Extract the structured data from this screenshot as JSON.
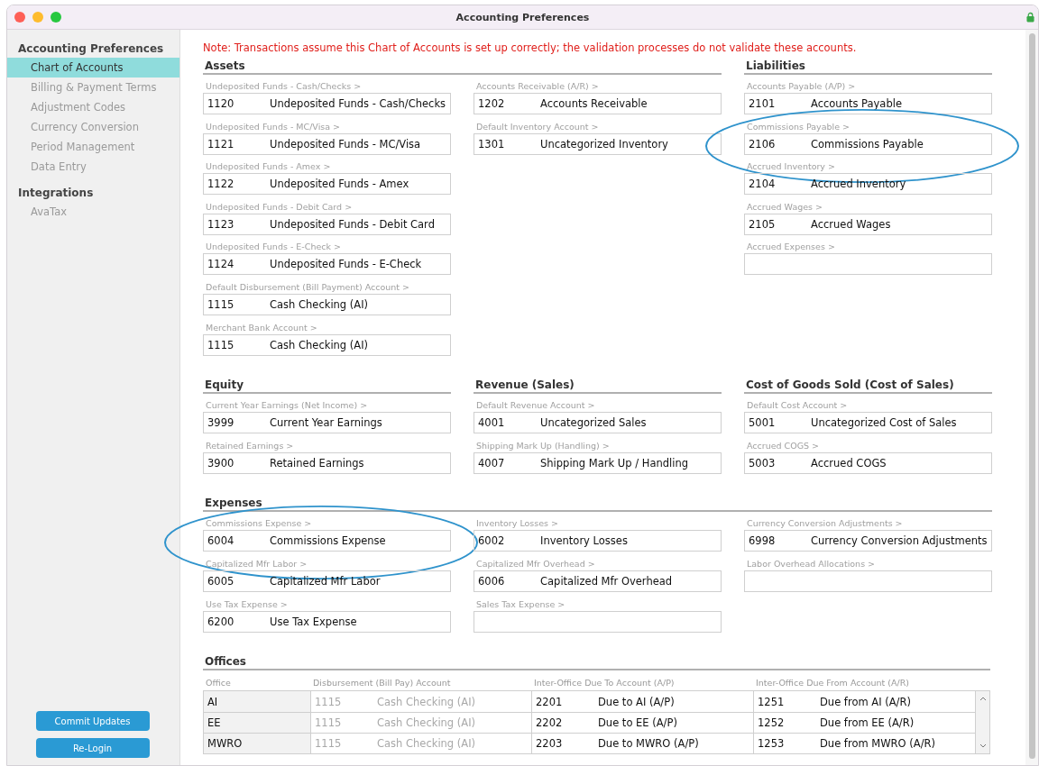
{
  "window": {
    "title": "Accounting Preferences"
  },
  "sidebar": {
    "groups": [
      {
        "title": "Accounting Preferences",
        "items": [
          {
            "label": "Chart of Accounts",
            "selected": true
          },
          {
            "label": "Billing & Payment Terms",
            "selected": false
          },
          {
            "label": "Adjustment Codes",
            "selected": false
          },
          {
            "label": "Currency Conversion",
            "selected": false
          },
          {
            "label": "Period Management",
            "selected": false
          },
          {
            "label": "Data Entry",
            "selected": false
          }
        ]
      },
      {
        "title": "Integrations",
        "items": [
          {
            "label": "AvaTax",
            "selected": false
          }
        ]
      }
    ],
    "buttons": [
      "Commit Updates",
      "Re-Login"
    ]
  },
  "note": "Note: Transactions assume this Chart of Accounts is set up correctly; the validation processes do not validate these accounts.",
  "section_rows": [
    [
      {
        "title": "Assets",
        "columns": [
          [
            {
              "label": "Undeposited Funds - Cash/Checks >",
              "number": "1120",
              "name": "Undeposited Funds - Cash/Checks",
              "circled": false
            },
            {
              "label": "Undeposited Funds - MC/Visa >",
              "number": "1121",
              "name": "Undeposited Funds - MC/Visa",
              "circled": false
            },
            {
              "label": "Undeposited Funds - Amex >",
              "number": "1122",
              "name": "Undeposited Funds - Amex",
              "circled": false
            },
            {
              "label": "Undeposited Funds - Debit Card >",
              "number": "1123",
              "name": "Undeposited Funds - Debit Card",
              "circled": false
            },
            {
              "label": "Undeposited Funds - E-Check >",
              "number": "1124",
              "name": "Undeposited Funds - E-Check",
              "circled": false
            },
            {
              "label": "Default Disbursement (Bill Payment) Account >",
              "number": "1115",
              "name": "Cash Checking (AI)",
              "circled": false
            },
            {
              "label": "Merchant Bank Account >",
              "number": "1115",
              "name": "Cash Checking (AI)",
              "circled": false
            }
          ],
          [
            {
              "label": "Accounts Receivable (A/R) >",
              "number": "1202",
              "name": "Accounts Receivable",
              "circled": false
            },
            {
              "label": "Default Inventory Account >",
              "number": "1301",
              "name": "Uncategorized Inventory",
              "circled": false
            }
          ]
        ]
      },
      {
        "title": "Liabilities",
        "columns": [
          [
            {
              "label": "Accounts Payable (A/P) >",
              "number": "2101",
              "name": "Accounts Payable",
              "circled": false
            },
            {
              "label": "Commissions Payable >",
              "number": "2106",
              "name": "Commissions Payable",
              "circled": true
            },
            {
              "label": "Accrued Inventory >",
              "number": "2104",
              "name": "Accrued Inventory",
              "circled": false
            },
            {
              "label": "Accrued Wages >",
              "number": "2105",
              "name": "Accrued Wages",
              "circled": false
            },
            {
              "label": "Accrued Expenses >",
              "circled": false
            }
          ]
        ]
      }
    ],
    [
      {
        "title": "Equity",
        "columns": [
          [
            {
              "label": "Current Year Earnings (Net Income) >",
              "number": "3999",
              "name": "Current Year Earnings",
              "circled": false
            },
            {
              "label": "Retained Earnings >",
              "number": "3900",
              "name": "Retained Earnings",
              "circled": false
            }
          ]
        ]
      },
      {
        "title": "Revenue (Sales)",
        "columns": [
          [
            {
              "label": "Default Revenue Account >",
              "number": "4001",
              "name": "Uncategorized Sales",
              "circled": false
            },
            {
              "label": "Shipping Mark Up (Handling) >",
              "number": "4007",
              "name": "Shipping Mark Up / Handling",
              "circled": false
            }
          ]
        ]
      },
      {
        "title": "Cost of Goods Sold (Cost of Sales)",
        "columns": [
          [
            {
              "label": "Default Cost Account >",
              "number": "5001",
              "name": "Uncategorized Cost of Sales",
              "circled": false
            },
            {
              "label": "Accrued COGS >",
              "number": "5003",
              "name": "Accrued COGS",
              "circled": false
            }
          ]
        ]
      }
    ],
    [
      {
        "title": "Expenses",
        "columns": [
          [
            {
              "label": "Commissions Expense >",
              "number": "6004",
              "name": "Commissions Expense",
              "circled": true
            },
            {
              "label": "Capitalized Mfr Labor >",
              "number": "6005",
              "name": "Capitalized Mfr Labor",
              "circled": false
            },
            {
              "label": "Use Tax Expense >",
              "number": "6200",
              "name": "Use Tax Expense",
              "circled": false
            }
          ],
          [
            {
              "label": "Inventory Losses >",
              "number": "6002",
              "name": "Inventory Losses",
              "circled": false
            },
            {
              "label": "Capitalized Mfr Overhead >",
              "number": "6006",
              "name": "Capitalized Mfr Overhead",
              "circled": false
            },
            {
              "label": "Sales Tax Expense >",
              "circled": false
            }
          ],
          [
            {
              "label": "Currency Conversion Adjustments >",
              "number": "6998",
              "name": "Currency Conversion Adjustments",
              "circled": false
            },
            {
              "label": "Labor Overhead Allocations >",
              "circled": false
            }
          ]
        ]
      }
    ]
  ],
  "offices": {
    "title": "Offices",
    "columns": [
      "Office",
      "Disbursement (Bill Pay) Account",
      "Inter-Office Due To Account (A/P)",
      "Inter-Office Due From Account (A/R)"
    ],
    "rows": [
      {
        "office": "AI",
        "disbursement": {
          "number": "1115",
          "name": "Cash Checking (AI)",
          "disabled": true
        },
        "due_to": {
          "number": "2201",
          "name": "Due to AI (A/P)",
          "disabled": false
        },
        "due_from": {
          "number": "1251",
          "name": "Due from AI (A/R)",
          "disabled": false
        }
      },
      {
        "office": "EE",
        "disbursement": {
          "number": "1115",
          "name": "Cash Checking (AI)",
          "disabled": true
        },
        "due_to": {
          "number": "2202",
          "name": "Due to EE (A/P)",
          "disabled": false
        },
        "due_from": {
          "number": "1252",
          "name": "Due from EE (A/R)",
          "disabled": false
        }
      },
      {
        "office": "MWRO",
        "disbursement": {
          "number": "1115",
          "name": "Cash Checking (AI)",
          "disabled": true
        },
        "due_to": {
          "number": "2203",
          "name": "Due to MWRO (A/P)",
          "disabled": false
        },
        "due_from": {
          "number": "1253",
          "name": "Due from MWRO (A/R)",
          "disabled": false
        }
      }
    ]
  }
}
